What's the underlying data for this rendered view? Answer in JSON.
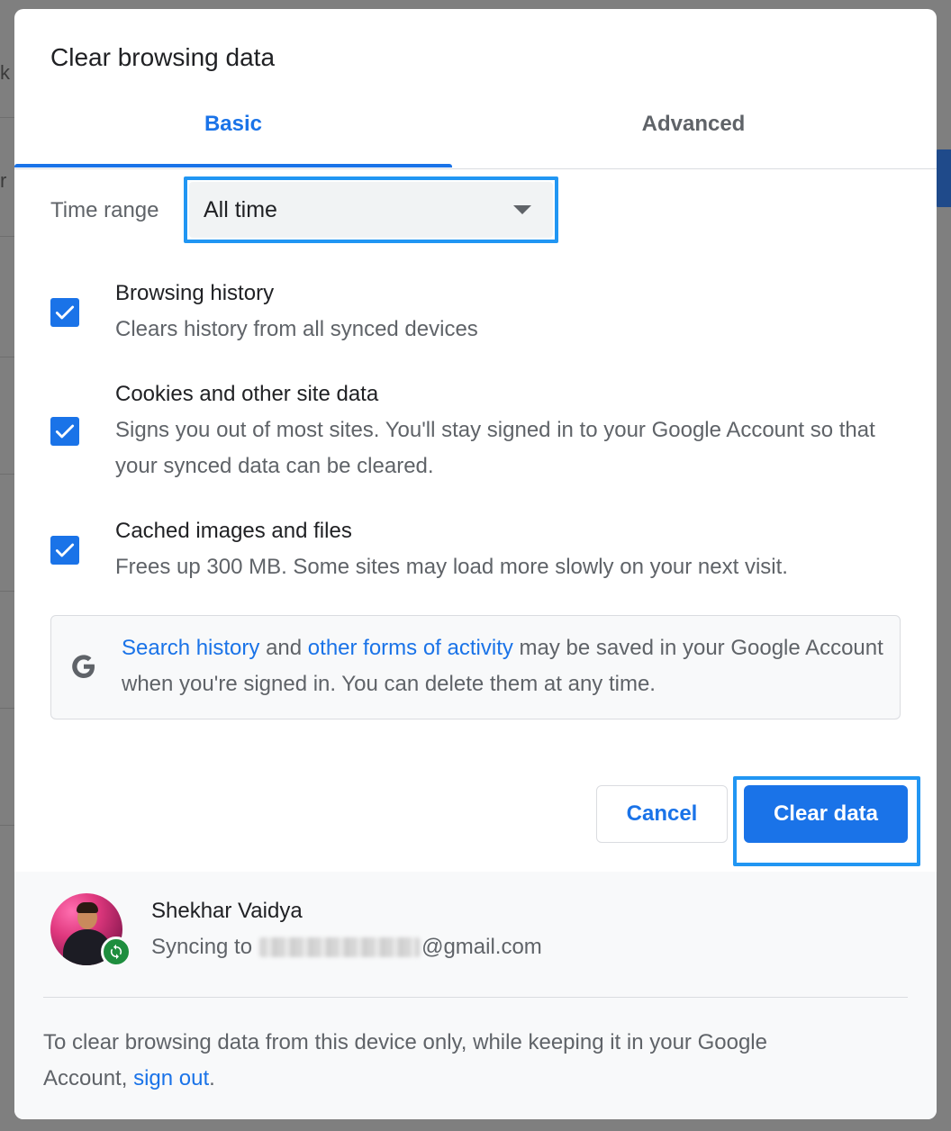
{
  "dialog": {
    "title": "Clear browsing data",
    "tabs": [
      {
        "label": "Basic",
        "active": true
      },
      {
        "label": "Advanced",
        "active": false
      }
    ]
  },
  "time_range": {
    "label": "Time range",
    "selected": "All time"
  },
  "options": [
    {
      "title": "Browsing history",
      "description": "Clears history from all synced devices",
      "checked": true
    },
    {
      "title": "Cookies and other site data",
      "description": "Signs you out of most sites. You'll stay signed in to your Google Account so that your synced data can be cleared.",
      "checked": true
    },
    {
      "title": "Cached images and files",
      "description": "Frees up 300 MB. Some sites may load more slowly on your next visit.",
      "checked": true
    }
  ],
  "info": {
    "link1": "Search history",
    "and": " and ",
    "link2": "other forms of activity",
    "rest": " may be saved in your Google Account when you're signed in. You can delete them at any time."
  },
  "buttons": {
    "cancel": "Cancel",
    "clear": "Clear data"
  },
  "account": {
    "name": "Shekhar Vaidya",
    "sync_prefix": "Syncing to",
    "email_suffix": "@gmail.com"
  },
  "footer": {
    "text": "To clear browsing data from this device only, while keeping it in your Google Account, ",
    "link": "sign out",
    "end": "."
  },
  "colors": {
    "accent": "#1a73e8",
    "focus_ring": "#2196f3",
    "sync_green": "#1e8e3e"
  }
}
